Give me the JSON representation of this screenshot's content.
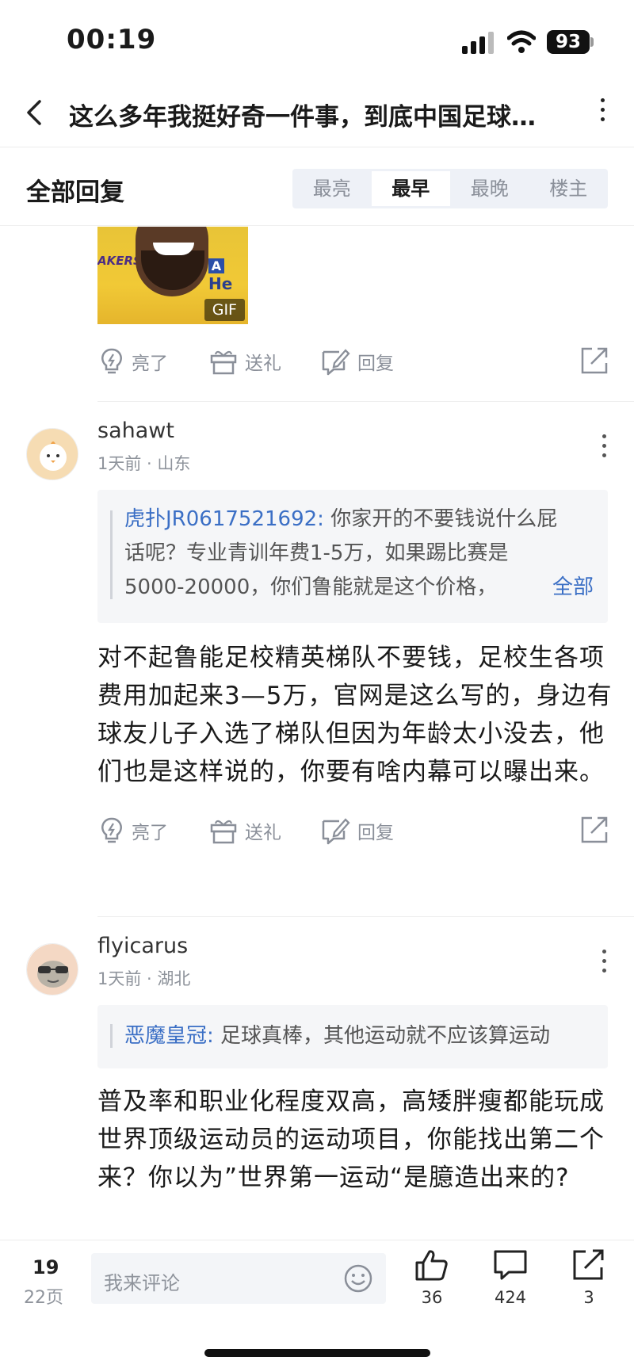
{
  "status_bar": {
    "time": "00:19",
    "battery": "93"
  },
  "header": {
    "title": "这么多年我挺好奇一件事，到底中国足球…"
  },
  "sort_bar": {
    "label": "全部回复",
    "tabs": [
      {
        "label": "最亮"
      },
      {
        "label": "最早"
      },
      {
        "label": "最晚"
      },
      {
        "label": "楼主"
      }
    ],
    "active": "最早"
  },
  "gif": {
    "badge": "GIF",
    "logo_text": "AKERS",
    "side_text": "He"
  },
  "actions": {
    "light": "亮了",
    "gift": "送礼",
    "reply": "回复"
  },
  "replies": [
    {
      "username": "sahawt",
      "meta": "1天前 · 山东",
      "quote": {
        "author": "虎扑JR0617521692:",
        "lines": [
          "你家开的不要钱说什么屁",
          "话呢？专业青训年费1-5万，如果踢比赛是",
          "5000-20000，你们鲁能就是这个价格，"
        ],
        "more": "全部"
      },
      "body": "对不起鲁能足校精英梯队不要钱，足校生各项费用加起来3—5万，官网是这么写的，身边有球友儿子入选了梯队但因为年龄太小没去，他们也是这样说的，你要有啥内幕可以曝出来。"
    },
    {
      "username": "flyicarus",
      "meta": "1天前 · 湖北",
      "quote": {
        "author": "恶魔皇冠:",
        "lines": [
          " 足球真棒，其他运动就不应该算运动"
        ]
      },
      "body": "普及率和职业化程度双高，高矮胖瘦都能玩成世界顶级运动员的运动项目，你能找出第二个来？你以为”世界第一运动“是臆造出来的?"
    }
  ],
  "bottom_bar": {
    "page": "19",
    "total_pages": "22页",
    "comment_placeholder": "我来评论",
    "likes": "36",
    "comments": "424",
    "shares": "3"
  }
}
